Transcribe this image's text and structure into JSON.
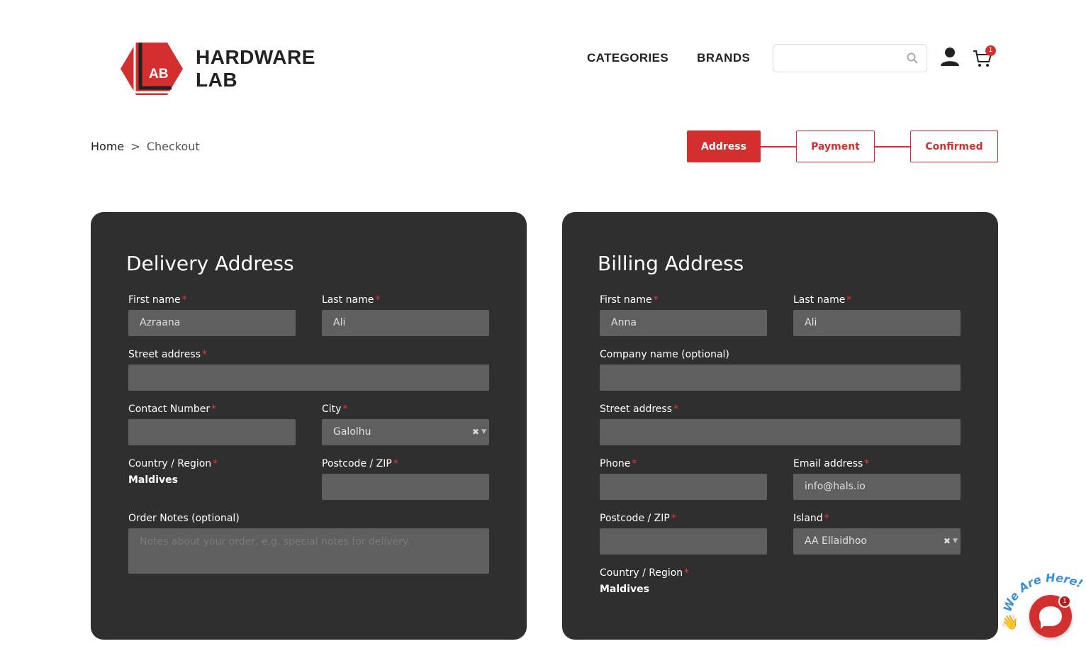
{
  "brand": {
    "logo_mark": "AB",
    "name_line1": "HARDWARE",
    "name_line2": "LAB"
  },
  "nav": {
    "categories": "CATEGORIES",
    "brands": "BRANDS"
  },
  "search": {
    "value": "",
    "placeholder": ""
  },
  "cart": {
    "count": "1"
  },
  "breadcrumb": {
    "home": "Home",
    "separator": ">",
    "current": "Checkout"
  },
  "steps": [
    "Address",
    "Payment",
    "Confirmed"
  ],
  "delivery": {
    "title": "Delivery Address",
    "first_name_label": "First name",
    "first_name_value": "Azraana",
    "last_name_label": "Last name",
    "last_name_value": "Ali",
    "street_label": "Street address",
    "street_value": "",
    "contact_label": "Contact Number",
    "contact_value": "",
    "city_label": "City",
    "city_value": "Galolhu",
    "country_label": "Country / Region",
    "country_value": "Maldives",
    "postcode_label": "Postcode / ZIP",
    "postcode_value": "",
    "notes_label": "Order Notes (optional)",
    "notes_placeholder": "Notes about your order, e.g. special notes for delivery."
  },
  "billing": {
    "title": "Billing Address",
    "first_name_label": "First name",
    "first_name_value": "Anna",
    "last_name_label": "Last name",
    "last_name_value": "Ali",
    "company_label": "Company name (optional)",
    "company_value": "",
    "street_label": "Street address",
    "street_value": "",
    "phone_label": "Phone",
    "phone_value": "",
    "email_label": "Email address",
    "email_value": "info@hals.io",
    "postcode_label": "Postcode / ZIP",
    "postcode_value": "",
    "island_label": "Island",
    "island_value": "AA Ellaidhoo",
    "country_label": "Country / Region",
    "country_value": "Maldives"
  },
  "chat": {
    "tagline": "We Are Here!",
    "badge": "1"
  },
  "colors": {
    "accent": "#d32f2f",
    "panel_bg": "#2f2f2f",
    "input_bg": "#5f5f5f"
  }
}
